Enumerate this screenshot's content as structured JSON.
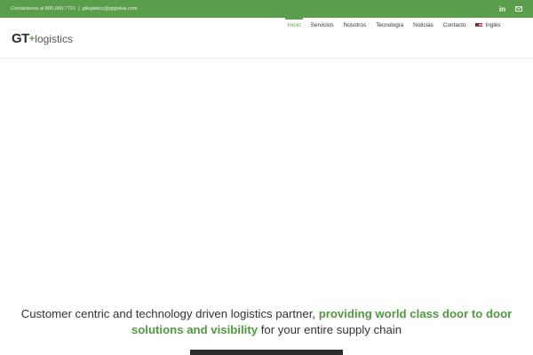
{
  "topbar": {
    "phone_text": "Contáctenos al 800.000.7721",
    "separator": "|",
    "email_text": "gtlogistics@gtglobal.com",
    "icons": [
      "linkedin-icon",
      "mail-icon"
    ],
    "background": "#5a9e4b"
  },
  "header": {
    "logo": {
      "mark": "GT",
      "plus": "+",
      "word": "logistics"
    },
    "nav": [
      {
        "label": "Inicio",
        "active": true
      },
      {
        "label": "Servicios"
      },
      {
        "label": "Nosotros"
      },
      {
        "label": "Tecnología"
      },
      {
        "label": "Noticias"
      },
      {
        "label": "Contacto"
      },
      {
        "label": "Inglés",
        "icon": "us-flag-icon"
      }
    ],
    "search_icon": "search-icon"
  },
  "tagline": {
    "part1": "Customer centric and technology driven logistics partner, ",
    "highlight": "providing world class door to door solutions and visibility",
    "part2": " for your entire supply chain"
  },
  "colors": {
    "accent": "#5a9e4b",
    "text": "#333333"
  }
}
